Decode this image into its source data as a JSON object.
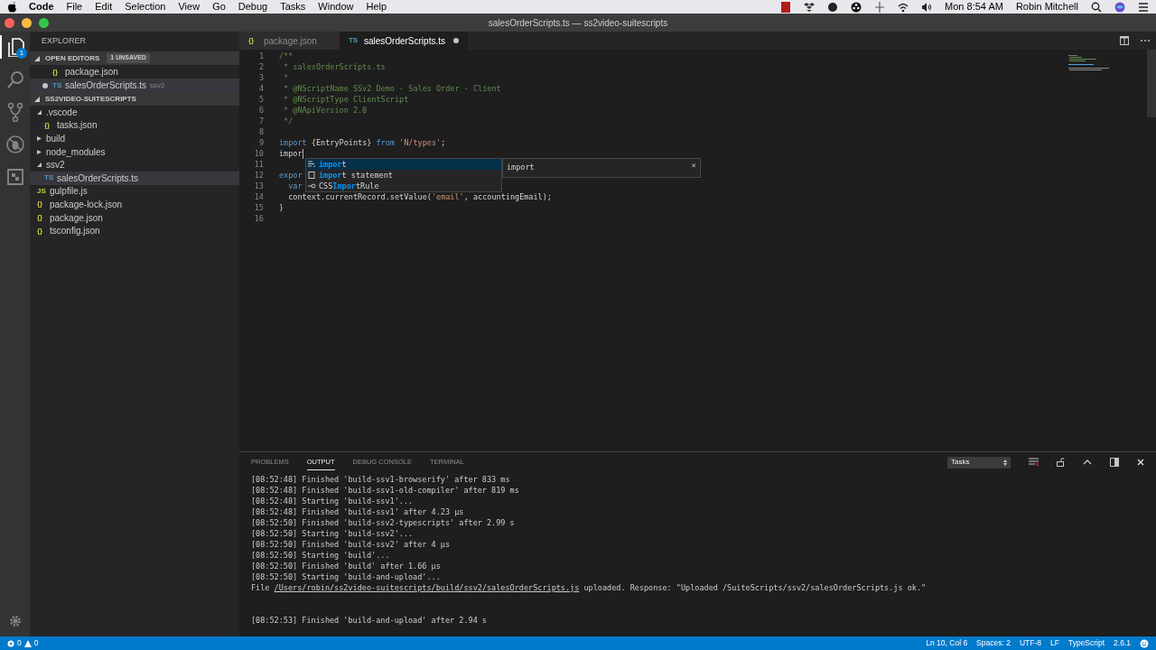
{
  "menubar": {
    "items": [
      {
        "label": "Code",
        "bold": true
      },
      {
        "label": "File",
        "bold": false
      },
      {
        "label": "Edit",
        "bold": false
      },
      {
        "label": "Selection",
        "bold": false
      },
      {
        "label": "View",
        "bold": false
      },
      {
        "label": "Go",
        "bold": false
      },
      {
        "label": "Debug",
        "bold": false
      },
      {
        "label": "Tasks",
        "bold": false
      },
      {
        "label": "Window",
        "bold": false
      },
      {
        "label": "Help",
        "bold": false
      }
    ],
    "clock": "Mon 8:54 AM",
    "user": "Robin Mitchell"
  },
  "window": {
    "title": "salesOrderScripts.ts — ss2video-suitescripts"
  },
  "activity_bar": {
    "items": [
      {
        "kind": "files",
        "selected": true,
        "badge": "1"
      },
      {
        "kind": "search",
        "selected": false
      },
      {
        "kind": "scm",
        "selected": false
      },
      {
        "kind": "debug",
        "selected": false
      },
      {
        "kind": "extensions",
        "selected": false
      }
    ]
  },
  "sidebar": {
    "title": "EXPLORER",
    "open_editors": {
      "title": "OPEN EDITORS",
      "badge": "1 UNSAVED",
      "expanded": true,
      "items": [
        {
          "name": "package.json",
          "icon": "{}",
          "dirty": false,
          "selected": false
        },
        {
          "name": "salesOrderScripts.ts",
          "icon": "TS",
          "dirty": true,
          "description": "ssv2",
          "selected": true
        }
      ]
    },
    "folder": {
      "title": "SS2VIDEO-SUITESCRIPTS",
      "expanded": true,
      "items": [
        {
          "name": ".vscode",
          "kind": "folder",
          "expanded": true,
          "selected": false,
          "children": [
            {
              "name": "tasks.json",
              "kind": "file",
              "icon": "{}",
              "selected": false
            }
          ]
        },
        {
          "name": "build",
          "kind": "folder",
          "expanded": false,
          "selected": false
        },
        {
          "name": "node_modules",
          "kind": "folder",
          "expanded": false,
          "selected": false
        },
        {
          "name": "ssv2",
          "kind": "folder",
          "expanded": true,
          "selected": false,
          "children": [
            {
              "name": "salesOrderScripts.ts",
              "kind": "file",
              "icon": "TS",
              "selected": true
            }
          ]
        },
        {
          "name": "gulpfile.js",
          "kind": "file",
          "icon": "JS",
          "selected": false
        },
        {
          "name": "package-lock.json",
          "kind": "file",
          "icon": "{}",
          "selected": false
        },
        {
          "name": "package.json",
          "kind": "file",
          "icon": "{}",
          "selected": false
        },
        {
          "name": "tsconfig.json",
          "kind": "file",
          "icon": "{}",
          "selected": false
        }
      ]
    }
  },
  "editor_tabs": [
    {
      "name": "package.json",
      "icon": "{}",
      "selected": false,
      "dirty": false
    },
    {
      "name": "salesOrderScripts.ts",
      "icon": "TS",
      "selected": true,
      "dirty": true
    }
  ],
  "code_lines": [
    {
      "number": "1",
      "tokens": [
        {
          "kind": "comment",
          "text": "/**"
        }
      ]
    },
    {
      "number": "2",
      "tokens": [
        {
          "kind": "comment",
          "text": " * salesOrderScripts.ts"
        }
      ]
    },
    {
      "number": "3",
      "tokens": [
        {
          "kind": "comment",
          "text": " *"
        }
      ]
    },
    {
      "number": "4",
      "tokens": [
        {
          "kind": "comment",
          "text": " * @NScriptName SSv2 Demo - Sales Order - Client"
        }
      ]
    },
    {
      "number": "5",
      "tokens": [
        {
          "kind": "comment",
          "text": " * @NScriptType ClientScript"
        }
      ]
    },
    {
      "number": "6",
      "tokens": [
        {
          "kind": "comment",
          "text": " * @NApiVersion 2.0"
        }
      ]
    },
    {
      "number": "7",
      "tokens": [
        {
          "kind": "comment",
          "text": " */"
        }
      ]
    },
    {
      "number": "8"
    },
    {
      "number": "9",
      "tokens": [
        {
          "kind": "keyword",
          "text": "import"
        },
        {
          "kind": "plain",
          "text": " {EntryPoints} "
        },
        {
          "kind": "keyword",
          "text": "from"
        },
        {
          "kind": "string",
          "text": " 'N/types'"
        },
        {
          "kind": "plain",
          "text": ";"
        }
      ]
    },
    {
      "number": "10",
      "tokens": [
        {
          "kind": "plain",
          "text": "impor"
        }
      ],
      "cursor": true
    },
    {
      "number": "11"
    },
    {
      "number": "12",
      "tokens": [
        {
          "kind": "keyword",
          "text": "expor"
        }
      ]
    },
    {
      "number": "13",
      "tokens": [
        {
          "kind": "keyword",
          "text": "  var"
        }
      ]
    },
    {
      "number": "14",
      "tokens": [
        {
          "kind": "plain",
          "text": "  context.currentRecord.setValue("
        },
        {
          "kind": "string",
          "text": "'email'"
        },
        {
          "kind": "plain",
          "text": ", accountingEmail);"
        }
      ]
    },
    {
      "number": "15",
      "tokens": [
        {
          "kind": "plain",
          "text": "}"
        }
      ]
    },
    {
      "number": "16"
    }
  ],
  "suggest": {
    "items": [
      {
        "kind": "keyword",
        "match": "impor",
        "rest": "t",
        "selected": true
      },
      {
        "kind": "snippet",
        "match": "impor",
        "rest": "t statement",
        "selected": false
      },
      {
        "kind": "interface",
        "prefix": "CSS",
        "match": "Impor",
        "rest": "tRule",
        "selected": false
      }
    ],
    "detail": "import",
    "close": "×"
  },
  "panel": {
    "tabs": [
      {
        "label": "PROBLEMS",
        "selected": false
      },
      {
        "label": "OUTPUT",
        "selected": true
      },
      {
        "label": "DEBUG CONSOLE",
        "selected": false
      },
      {
        "label": "TERMINAL",
        "selected": false
      }
    ],
    "channel": "Tasks",
    "lines": [
      {
        "parts": [
          {
            "kind": "text",
            "text": "[08:52:48] Finished 'build-ssv1-browserify' after 833 ms"
          }
        ]
      },
      {
        "parts": [
          {
            "kind": "text",
            "text": "[08:52:48] Finished 'build-ssv1-old-compiler' after 819 ms"
          }
        ]
      },
      {
        "parts": [
          {
            "kind": "text",
            "text": "[08:52:48] Starting 'build-ssv1'..."
          }
        ]
      },
      {
        "parts": [
          {
            "kind": "text",
            "text": "[08:52:48] Finished 'build-ssv1' after 4.23 μs"
          }
        ]
      },
      {
        "parts": [
          {
            "kind": "text",
            "text": "[08:52:50] Finished 'build-ssv2-typescripts' after 2.99 s"
          }
        ]
      },
      {
        "parts": [
          {
            "kind": "text",
            "text": "[08:52:50] Starting 'build-ssv2'..."
          }
        ]
      },
      {
        "parts": [
          {
            "kind": "text",
            "text": "[08:52:50] Finished 'build-ssv2' after 4 μs"
          }
        ]
      },
      {
        "parts": [
          {
            "kind": "text",
            "text": "[08:52:50] Starting 'build'..."
          }
        ]
      },
      {
        "parts": [
          {
            "kind": "text",
            "text": "[08:52:50] Finished 'build' after 1.66 μs"
          }
        ]
      },
      {
        "parts": [
          {
            "kind": "text",
            "text": "[08:52:50] Starting 'build-and-upload'..."
          }
        ]
      },
      {
        "parts": [
          {
            "kind": "text",
            "text": "File "
          },
          {
            "kind": "link",
            "text": "/Users/robin/ss2video-suitescripts/build/ssv2/salesOrderScripts.js"
          },
          {
            "kind": "text",
            "text": " uploaded. Response: \"Uploaded /SuiteScripts/ssv2/salesOrderScripts.js ok.\""
          }
        ]
      },
      {
        "kind": "blank"
      },
      {
        "kind": "blank"
      },
      {
        "kind": "text",
        "parts": [
          {
            "kind": "text",
            "text": "[08:52:53] Finished 'build-and-upload' after 2.94 s"
          }
        ]
      }
    ]
  },
  "status_bar": {
    "errors": "0",
    "warnings": "0",
    "items": [
      "Ln 10, Col 6",
      "Spaces: 2",
      "UTF-8",
      "LF",
      "TypeScript",
      "2.6.1"
    ]
  }
}
